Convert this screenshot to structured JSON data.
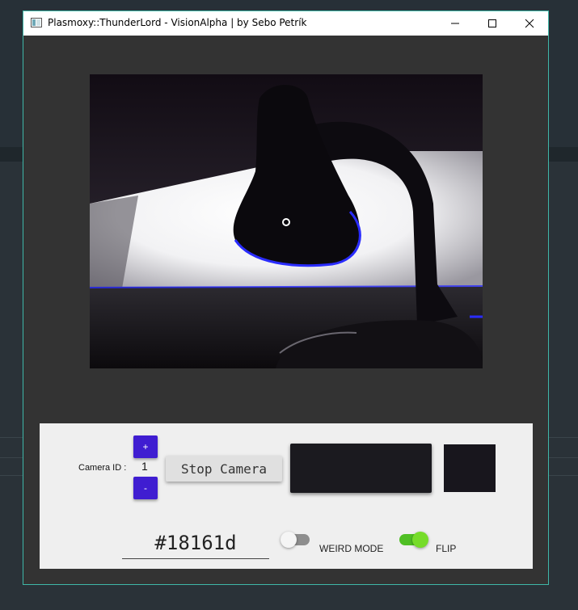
{
  "window": {
    "title": "Plasmoxy::ThunderLord - VisionAlpha | by Sebo Petrík",
    "minimize_icon": "minimize-icon",
    "maximize_icon": "maximize-icon",
    "close_icon": "close-icon",
    "border_color": "#3fb7a8"
  },
  "camera_view": {
    "description_icon": "desk-lamp-webcam-feed"
  },
  "controls": {
    "camera_id_label": "Camera ID :",
    "camera_id_value": "1",
    "increment_label": "+",
    "decrement_label": "-",
    "stop_camera_label": "Stop Camera",
    "accent_color": "#3f1dd1",
    "color_hex": "#18161d",
    "weird_mode": {
      "label": "WEIRD MODE",
      "on": false
    },
    "flip": {
      "label": "FLIP",
      "on": true
    }
  }
}
